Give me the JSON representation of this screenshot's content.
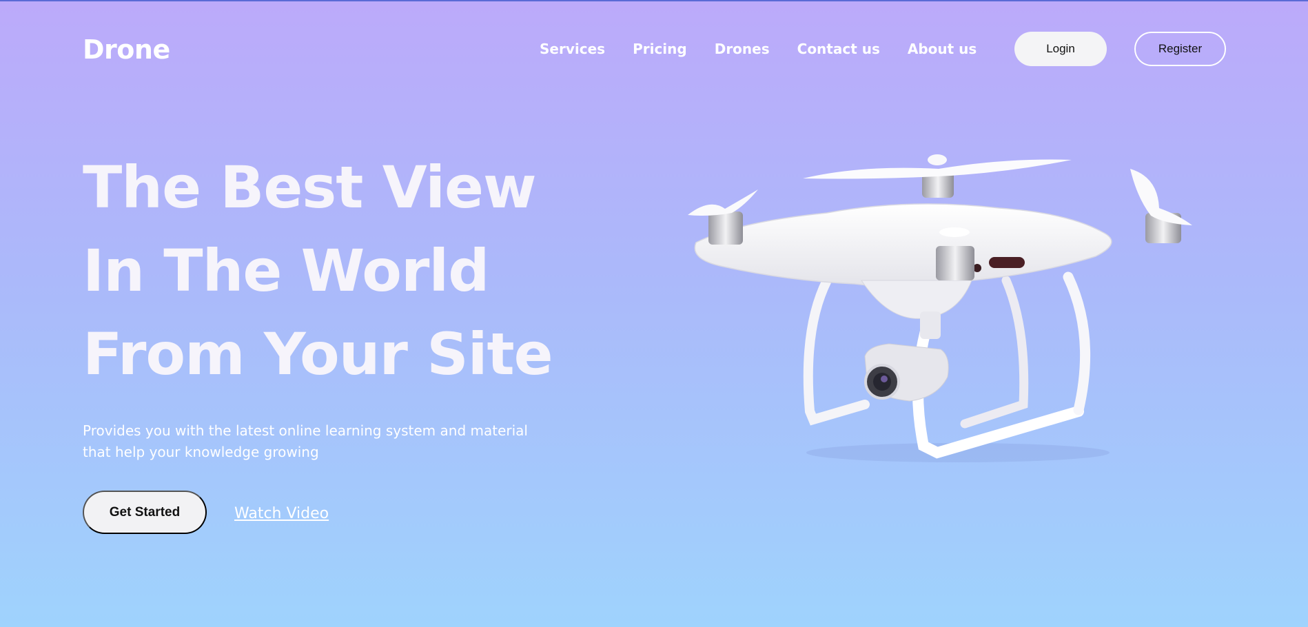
{
  "brand": {
    "logo_text": "Drone"
  },
  "nav": {
    "items": [
      {
        "label": "Services"
      },
      {
        "label": "Pricing"
      },
      {
        "label": "Drones"
      },
      {
        "label": "Contact us"
      },
      {
        "label": "About us"
      }
    ]
  },
  "auth": {
    "login_label": "Login",
    "register_label": "Register"
  },
  "hero": {
    "title_lines": [
      "The Best View",
      "In The World",
      "From Your Site"
    ],
    "subtitle_lines": [
      "Provides you with the latest online learning system and material",
      "that help your knowledge growing"
    ],
    "cta_label": "Get Started",
    "video_link_label": "Watch Video",
    "image": {
      "icon": "drone-illustration"
    }
  },
  "colors": {
    "gradient_top": "#bcaafa",
    "gradient_bottom": "#9fd3fd",
    "text": "#ffffff",
    "button_bg": "#f2f2f4"
  }
}
